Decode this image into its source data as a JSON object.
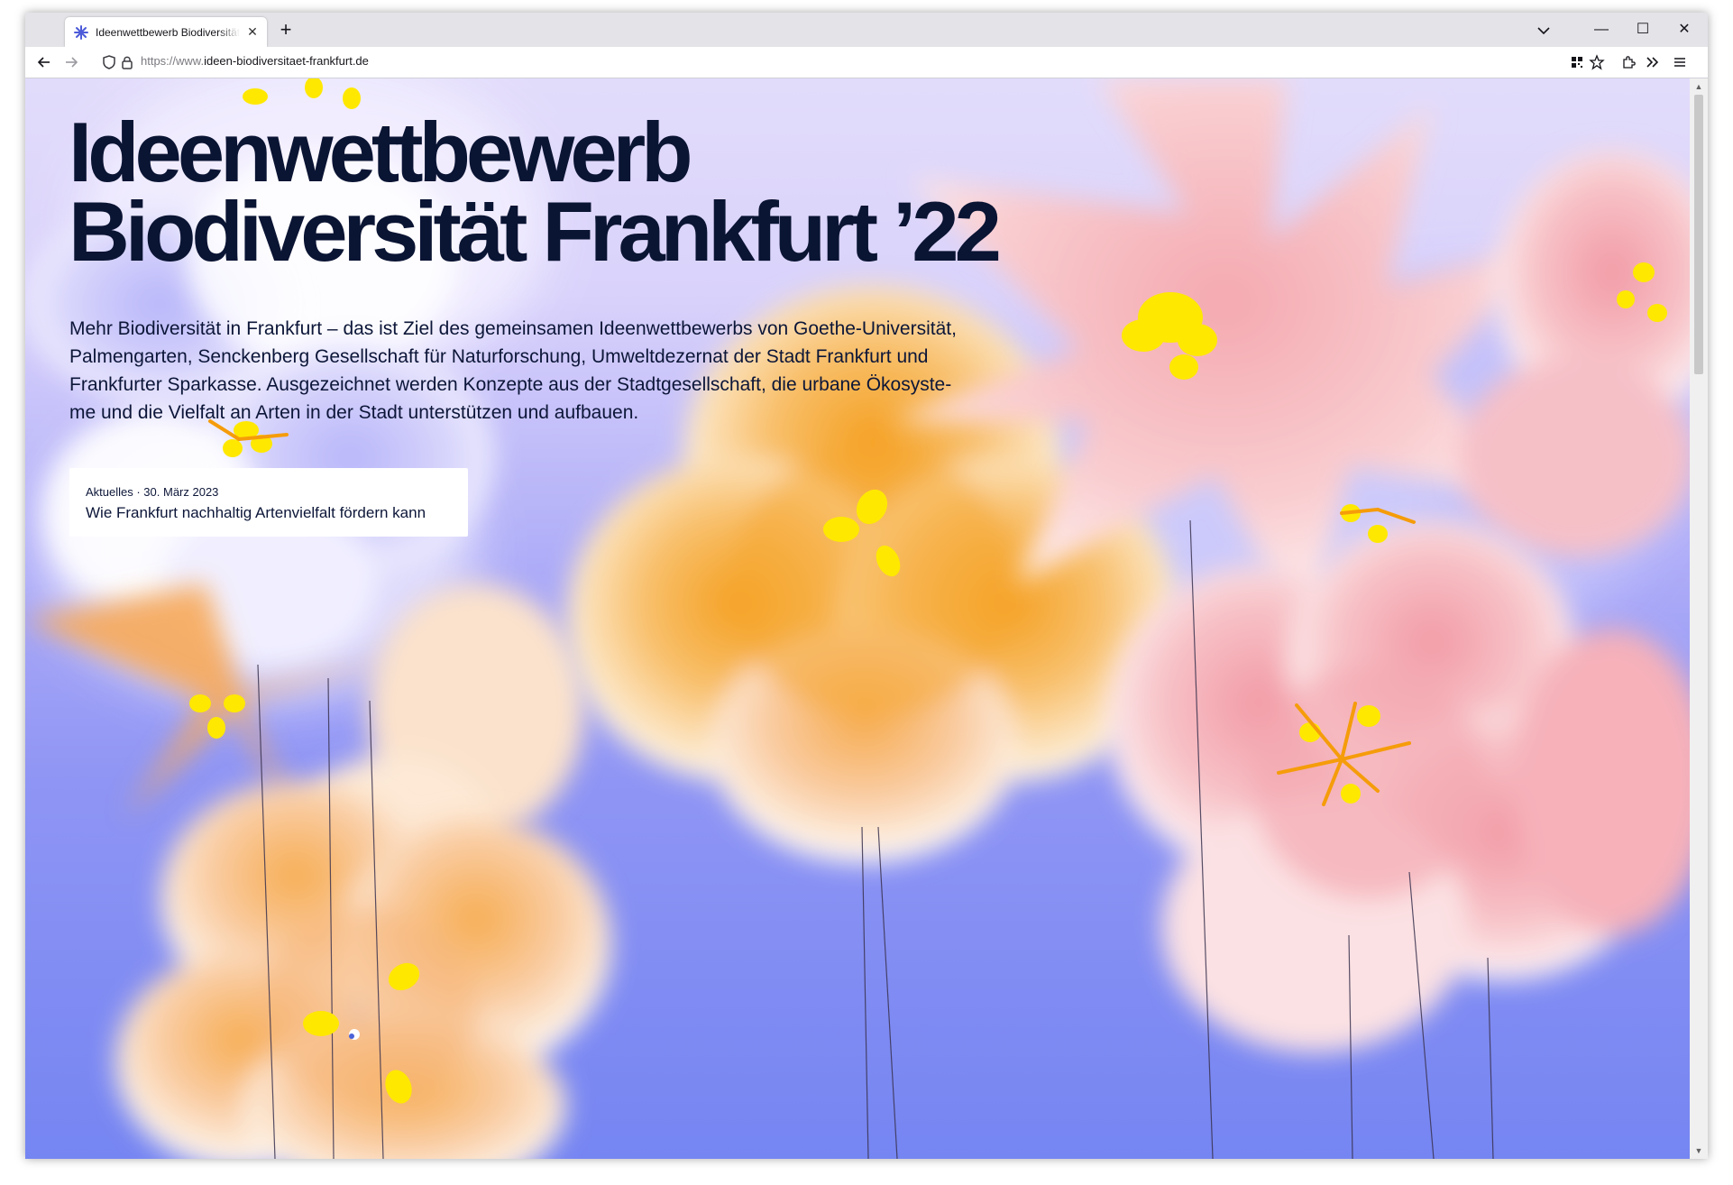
{
  "browser": {
    "tab_title": "Ideenwettbewerb Biodiversität F",
    "url_protocol": "https://www.",
    "url_host": "ideen-biodiversitaet-frankfurt.de",
    "new_tab_label": "+",
    "tab_close_label": "✕",
    "window_minimize": "—",
    "window_maximize": "☐",
    "window_close": "✕",
    "icons": [
      "back-icon",
      "forward-icon",
      "shield-icon",
      "lock-icon",
      "qr-icon",
      "bookmark-star-icon",
      "extensions-icon",
      "overflow-chevron-icon",
      "menu-icon"
    ]
  },
  "hero": {
    "title_line1": "Ideenwettbewerb",
    "title_line2": "Biodiversität Frankfurt ’22"
  },
  "intro": {
    "line1": "Mehr Biodiversität in Frankfurt – das ist Ziel des gemeinsamen Ideenwettbewerbs von Goethe-Universität,",
    "line2": "Palmengarten, Senckenberg Gesellschaft für Naturforschung, Umweltdezernat der Stadt Frankfurt und",
    "line3": "Frankfurter Sparkasse. Ausgezeichnet werden Konzepte aus der Stadtgesellschaft, die urbane Ökosyste-",
    "line4": "me und die Vielfalt an Arten in der Stadt unterstützen und aufbauen."
  },
  "news": {
    "meta": "Aktuelles · 30. März 2023",
    "headline": "Wie Frankfurt nachhaltig Artenvielfalt fördern kann"
  },
  "colors": {
    "title_text": "#0a1433",
    "sky_top": "#e2dcfb",
    "sky_bottom": "#7585f2",
    "petal_orange": "#f5a23a",
    "petal_pink": "#f3a5b0",
    "petal_lavender": "#c9c6fb",
    "stamen_yellow": "#ffe600"
  }
}
